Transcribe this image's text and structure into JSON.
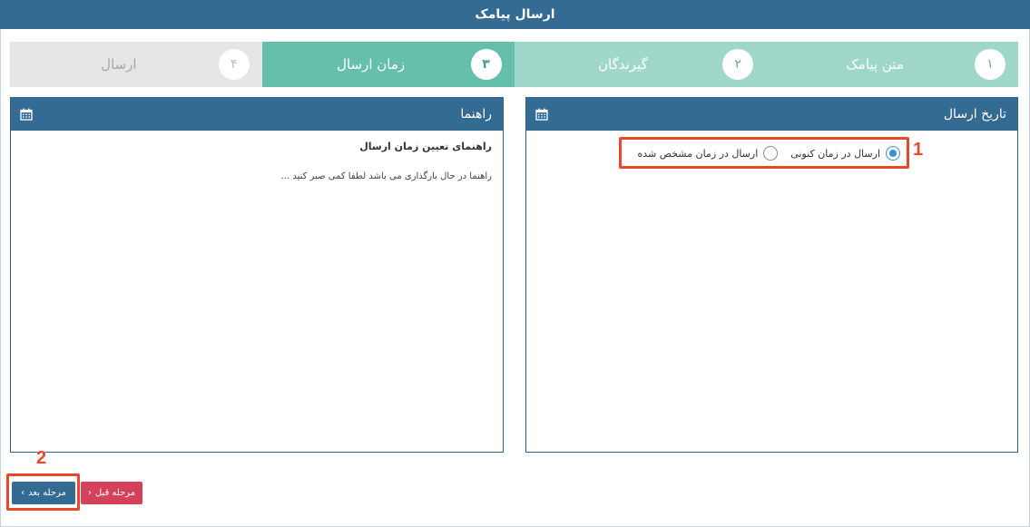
{
  "header": {
    "title": "ارسال پیامک"
  },
  "steps": [
    {
      "num": "۱",
      "label": "متن پیامک"
    },
    {
      "num": "۲",
      "label": "گیرندگان"
    },
    {
      "num": "۳",
      "label": "زمان ارسال"
    },
    {
      "num": "۴",
      "label": "ارسال"
    }
  ],
  "send_date_panel": {
    "title": "تاریخ ارسال",
    "icon": "calendar-icon",
    "options": [
      {
        "label": "ارسال در زمان کنونی",
        "selected": true
      },
      {
        "label": "ارسال در زمان مشخص شده",
        "selected": false
      }
    ]
  },
  "help_panel": {
    "title": "راهنما",
    "icon": "calendar-icon",
    "heading": "راهنمای تعیین زمان ارسال",
    "text": "راهنما در حال بارگذاری می باشد لطفا کمی صبر کنید ..."
  },
  "buttons": {
    "next_label": "مرحله بعد",
    "next_arrow": "›",
    "prev_label": "مرحله قبل",
    "prev_arrow": "‹"
  },
  "annotations": {
    "one": "1",
    "two": "2"
  },
  "colors": {
    "primary": "#346b93",
    "step_done": "#9fd8c8",
    "step_active": "#66bfaa",
    "step_todo": "#e6e6e6",
    "danger": "#d5405a",
    "annotation": "#e8492b"
  }
}
